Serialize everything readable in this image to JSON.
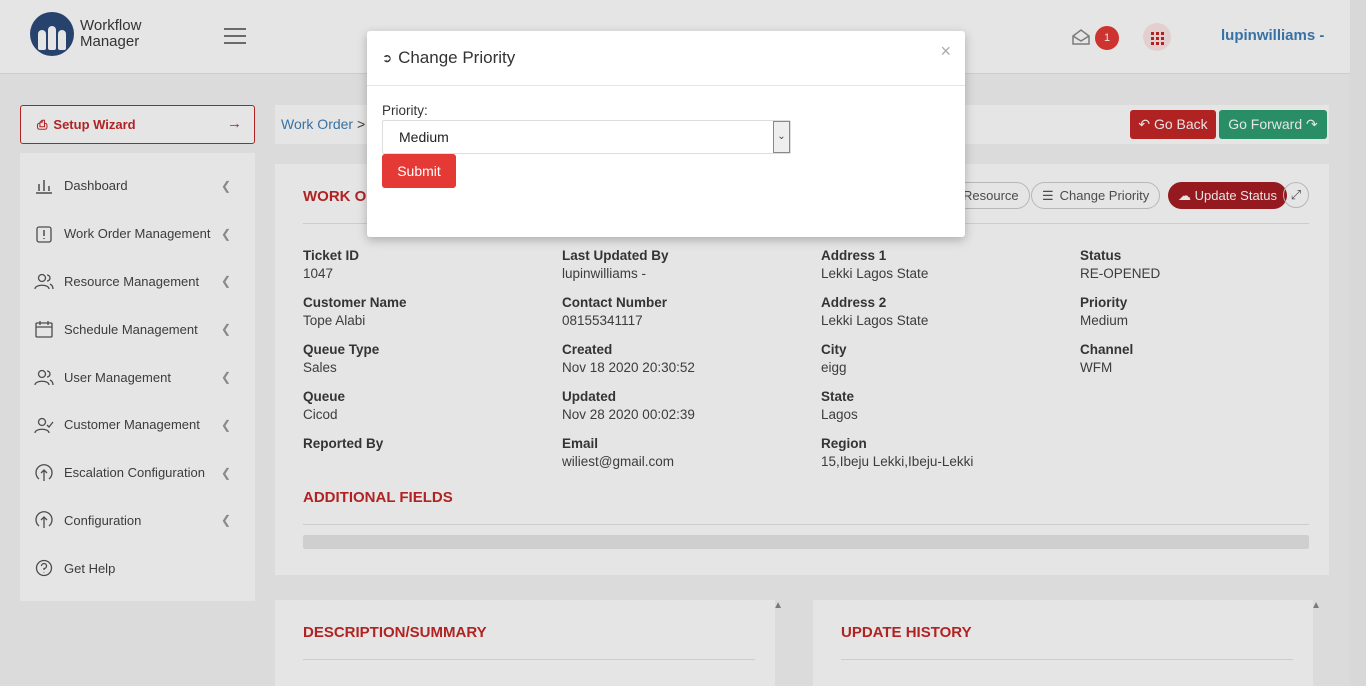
{
  "header": {
    "logo_line1": "Workflow",
    "logo_line2": "Manager",
    "notification_count": "1",
    "username": "lupinwilliams -"
  },
  "sidebar": {
    "setup_wizard": "Setup Wizard",
    "items": [
      {
        "label": "Dashboard",
        "icon": "bar-chart-icon"
      },
      {
        "label": "Work Order Management",
        "icon": "clipboard-icon"
      },
      {
        "label": "Resource Management",
        "icon": "users-icon"
      },
      {
        "label": "Schedule Management",
        "icon": "calendar-icon"
      },
      {
        "label": "User Management",
        "icon": "users-icon"
      },
      {
        "label": "Customer Management",
        "icon": "user-check-icon"
      },
      {
        "label": "Escalation Configuration",
        "icon": "upload-circle-icon"
      },
      {
        "label": "Configuration",
        "icon": "upload-circle-icon"
      },
      {
        "label": "Get Help",
        "icon": "help-circle-icon"
      }
    ]
  },
  "breadcrumb": {
    "root": "Work Order",
    "sep": ">"
  },
  "nav_buttons": {
    "back": "Go Back",
    "forward": "Go Forward"
  },
  "work_order": {
    "title": "WORK O",
    "actions": {
      "resource": "Resource",
      "change_priority": "Change Priority",
      "update_status": "Update Status"
    },
    "fields": {
      "ticket_id": {
        "label": "Ticket ID",
        "value": "1047"
      },
      "customer_name": {
        "label": "Customer Name",
        "value": "Tope Alabi"
      },
      "queue_type": {
        "label": "Queue Type",
        "value": "Sales"
      },
      "queue": {
        "label": "Queue",
        "value": "Cicod"
      },
      "reported_by": {
        "label": "Reported By",
        "value": ""
      },
      "last_updated_by": {
        "label": "Last Updated By",
        "value": "lupinwilliams -"
      },
      "contact_number": {
        "label": "Contact Number",
        "value": "08155341117"
      },
      "created": {
        "label": "Created",
        "value": "Nov 18 2020 20:30:52"
      },
      "updated": {
        "label": "Updated",
        "value": "Nov 28 2020 00:02:39"
      },
      "email": {
        "label": "Email",
        "value": "wiliest@gmail.com"
      },
      "address1": {
        "label": "Address 1",
        "value": "Lekki Lagos State"
      },
      "address2": {
        "label": "Address 2",
        "value": "Lekki Lagos State"
      },
      "city": {
        "label": "City",
        "value": "eigg"
      },
      "state": {
        "label": "State",
        "value": "Lagos"
      },
      "region": {
        "label": "Region",
        "value": "15,Ibeju Lekki,Ibeju-Lekki"
      },
      "status": {
        "label": "Status",
        "value": "RE-OPENED"
      },
      "priority": {
        "label": "Priority",
        "value": "Medium"
      },
      "channel": {
        "label": "Channel",
        "value": "WFM"
      }
    },
    "additional_fields_title": "ADDITIONAL FIELDS"
  },
  "panels": {
    "description_title": "DESCRIPTION/SUMMARY",
    "history_title": "UPDATE HISTORY"
  },
  "modal": {
    "title": "Change Priority",
    "close": "×",
    "priority_label": "Priority:",
    "priority_selected": "Medium",
    "submit": "Submit"
  },
  "colors": {
    "brand_red": "#c62828",
    "accent_blue": "#3f7fb8",
    "go_forward_green": "#2e9e72",
    "submit_red": "#e53935"
  }
}
